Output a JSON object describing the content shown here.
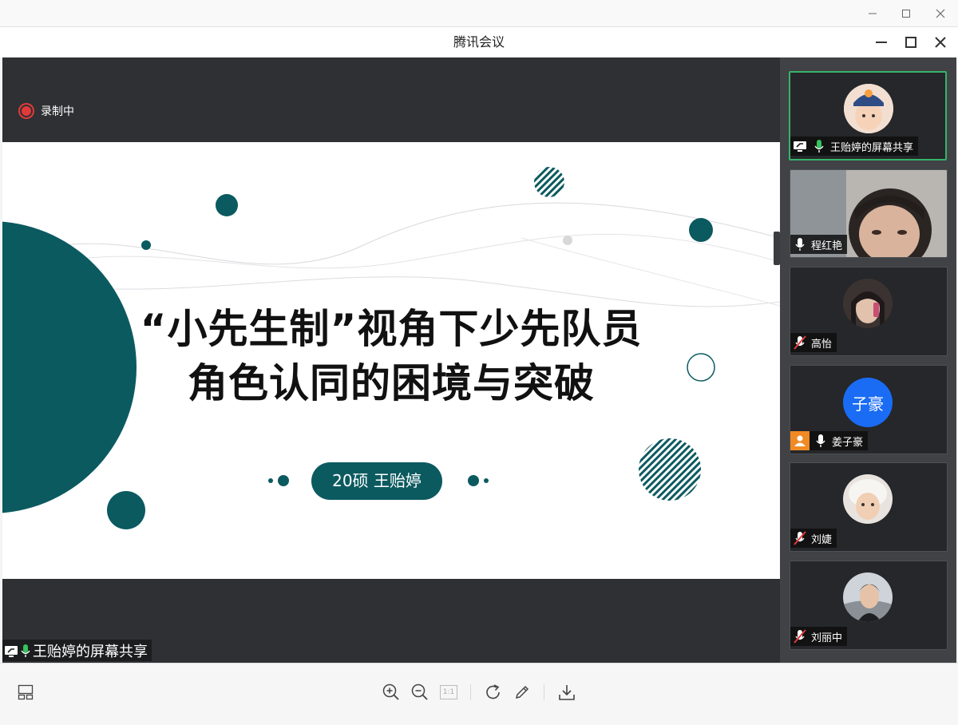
{
  "window": {
    "minimize_label": "—",
    "maximize_label": "☐",
    "close_label": "✕"
  },
  "meeting": {
    "title": "腾讯会议"
  },
  "recording": {
    "label": "录制中"
  },
  "slide": {
    "title_line1": "“小先生制”视角下少先队员",
    "title_line2": "角色认同的困境与突破",
    "presenter": "20硕 王贻婷"
  },
  "screen_share": {
    "label": "王贻婷的屏幕共享"
  },
  "participants": [
    {
      "name": "王贻婷的屏幕共享",
      "mic": "on",
      "sharing": true,
      "avatar": "child-photo"
    },
    {
      "name": "程红艳",
      "mic": "on",
      "video": true
    },
    {
      "name": "高怡",
      "mic": "muted",
      "avatar": "woman-photo"
    },
    {
      "name": "姜子豪",
      "mic": "on",
      "avatar_text": "子豪",
      "avatar_color": "#1a6cf5",
      "host": true
    },
    {
      "name": "刘婕",
      "mic": "muted",
      "avatar": "child-photo-2"
    },
    {
      "name": "刘丽中",
      "mic": "muted",
      "avatar": "man-photo"
    }
  ],
  "toolbar": {
    "actual_size_label": "1:1"
  },
  "colors": {
    "accent_teal": "#0b5a60",
    "active_border": "#37b36b",
    "mic_green": "#37c25a",
    "record_red": "#e23a3a"
  }
}
